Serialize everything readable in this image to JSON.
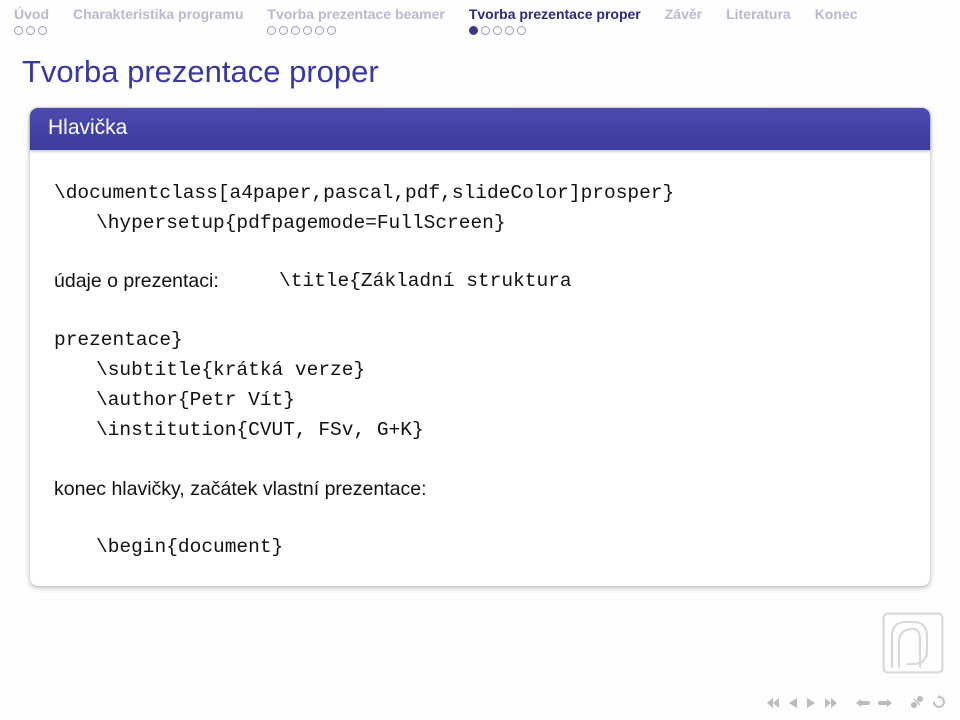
{
  "nav": [
    {
      "label": "Úvod",
      "dots": 3,
      "filled": -1,
      "active": false
    },
    {
      "label": "Charakteristika programu",
      "dots": 0,
      "filled": -1,
      "active": false
    },
    {
      "label": "Tvorba prezentace beamer",
      "dots": 6,
      "filled": -1,
      "active": false
    },
    {
      "label": "Tvorba prezentace proper",
      "dots": 5,
      "filled": 0,
      "active": true
    },
    {
      "label": "Závěr",
      "dots": 0,
      "filled": -1,
      "active": false
    },
    {
      "label": "Literatura",
      "dots": 0,
      "filled": -1,
      "active": false
    },
    {
      "label": "Konec",
      "dots": 0,
      "filled": -1,
      "active": false
    }
  ],
  "frametitle": "Tvorba prezentace proper",
  "block": {
    "title": "Hlavička",
    "line1": "\\documentclass[a4paper,pascal,pdf,slideColor]prosper}",
    "line2": "\\hypersetup{pdfpagemode=FullScreen}",
    "row_label": "údaje o prezentaci:",
    "row_value": "\\title{Základní struktura",
    "line3": "prezentace}",
    "line4": "\\subtitle{krátká verze}",
    "line5": "\\author{Petr Vít}",
    "line6": "\\institution{CVUT, FSv, G+K}",
    "line7": "konec hlavičky, začátek vlastní prezentace:",
    "line8": "\\begin{document}"
  }
}
